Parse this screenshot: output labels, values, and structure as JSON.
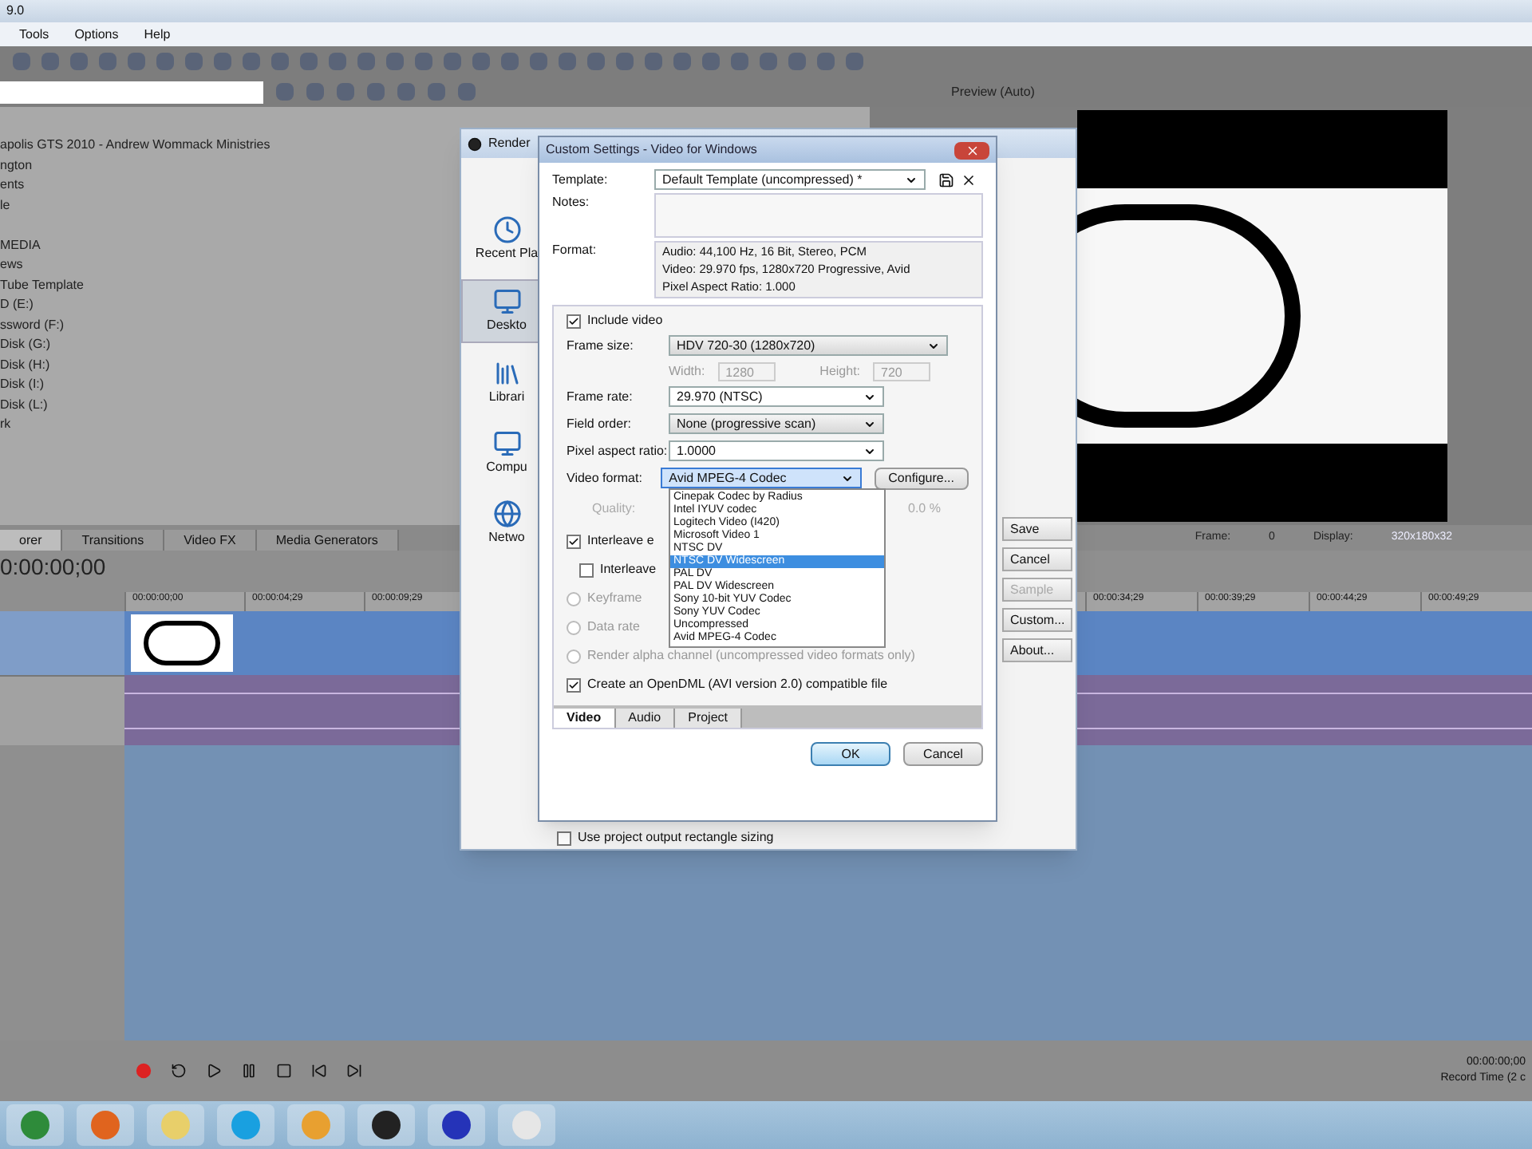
{
  "window": {
    "title": "9.0"
  },
  "menu": [
    {
      "label": "Tools"
    },
    {
      "label": "Options"
    },
    {
      "label": "Help"
    }
  ],
  "explorer": {
    "items": [
      "apolis GTS 2010 - Andrew Wommack Ministries",
      "ngton",
      "ents",
      "le",
      "MEDIA",
      "ews",
      "Tube Template",
      "D (E:)",
      "ssword (F:)",
      "Disk (G:)",
      "Disk (H:)",
      "Disk (I:)",
      "Disk (L:)",
      "rk"
    ]
  },
  "preview": {
    "mode": "Preview (Auto)",
    "frame_label": "Frame:",
    "frame": "0",
    "display_label": "Display:",
    "display": "320x180x32"
  },
  "window_tabs": [
    {
      "label": "orer",
      "selected": true
    },
    {
      "label": "Transitions",
      "selected": false
    },
    {
      "label": "Video FX",
      "selected": false
    },
    {
      "label": "Media Generators",
      "selected": false
    }
  ],
  "timeline": {
    "timecode": "0:00:00;00",
    "ruler_left": [
      "00:00:00;00",
      "00:00:04;29",
      "00:00:09;29"
    ],
    "ruler_right": [
      "00:00:34;29",
      "00:00:39;29",
      "00:00:44;29",
      "00:00:49;29"
    ]
  },
  "status": {
    "time": "00:00:00;00",
    "record": "Record Time (2 c"
  },
  "render_dialog": {
    "title": "Render",
    "places": [
      {
        "label": "Recent Pla",
        "selected": false
      },
      {
        "label": "Deskto",
        "selected": true
      },
      {
        "label": "Librari",
        "selected": false
      },
      {
        "label": "Compu",
        "selected": false
      },
      {
        "label": "Netwo",
        "selected": false
      }
    ],
    "buttons": [
      {
        "label": "Save",
        "disabled": false
      },
      {
        "label": "Cancel",
        "disabled": false
      },
      {
        "label": "Sample",
        "disabled": true
      },
      {
        "label": "Custom...",
        "disabled": false
      },
      {
        "label": "About...",
        "disabled": false
      }
    ],
    "footer": {
      "label": "Use project output rectangle sizing",
      "checked": false
    }
  },
  "custom_dialog": {
    "title": "Custom Settings - Video for Windows",
    "template_label": "Template:",
    "template": "Default Template (uncompressed) *",
    "notes_label": "Notes:",
    "format_label": "Format:",
    "format_lines": [
      "Audio: 44,100 Hz, 16 Bit, Stereo, PCM",
      "Video: 29.970 fps, 1280x720 Progressive, Avid",
      "Pixel Aspect Ratio: 1.000"
    ],
    "include_video": {
      "label": "Include video",
      "checked": true
    },
    "frame_size": {
      "label": "Frame size:",
      "value": "HDV 720-30 (1280x720)"
    },
    "width": {
      "label": "Width:",
      "value": "1280",
      "disabled": true
    },
    "height": {
      "label": "Height:",
      "value": "720",
      "disabled": true
    },
    "frame_rate": {
      "label": "Frame rate:",
      "value": "29.970 (NTSC)"
    },
    "field_order": {
      "label": "Field order:",
      "value": "None (progressive scan)"
    },
    "pixel_aspect": {
      "label": "Pixel aspect ratio:",
      "value": "1.0000"
    },
    "video_format": {
      "label": "Video format:",
      "value": "Avid MPEG-4 Codec",
      "configure": "Configure...",
      "expanded": true,
      "options": [
        {
          "label": "Cinepak Codec by Radius",
          "highlighted": false
        },
        {
          "label": "Intel IYUV codec",
          "highlighted": false
        },
        {
          "label": "Logitech Video (I420)",
          "highlighted": false
        },
        {
          "label": "Microsoft Video 1",
          "highlighted": false
        },
        {
          "label": "NTSC DV",
          "highlighted": false
        },
        {
          "label": "NTSC DV Widescreen",
          "highlighted": true
        },
        {
          "label": "PAL DV",
          "highlighted": false
        },
        {
          "label": "PAL DV Widescreen",
          "highlighted": false
        },
        {
          "label": "Sony 10-bit YUV Codec",
          "highlighted": false
        },
        {
          "label": "Sony YUV Codec",
          "highlighted": false
        },
        {
          "label": "Uncompressed",
          "highlighted": false
        },
        {
          "label": "Avid MPEG-4 Codec",
          "highlighted": false
        }
      ]
    },
    "quality": {
      "label": "Quality:",
      "value": "0.0 %"
    },
    "options": [
      {
        "kind": "checkbox",
        "label": "Interleave e",
        "checked": true,
        "disabled": false,
        "children": [
          {
            "label": "Interleave",
            "checked": false,
            "disabled": false
          }
        ]
      },
      {
        "kind": "radio",
        "label": "Keyframe",
        "checked": false,
        "disabled": true
      },
      {
        "kind": "radio",
        "label": "Data rate",
        "checked": false,
        "disabled": true
      },
      {
        "kind": "radio",
        "label": "Render alpha channel (uncompressed video formats only)",
        "checked": false,
        "disabled": true
      },
      {
        "kind": "checkbox",
        "label": "Create an OpenDML (AVI version 2.0) compatible file",
        "checked": true,
        "disabled": false
      }
    ],
    "tabs": [
      {
        "label": "Video",
        "selected": true
      },
      {
        "label": "Audio",
        "selected": false
      },
      {
        "label": "Project",
        "selected": false
      }
    ],
    "ok": "OK",
    "cancel": "Cancel"
  }
}
